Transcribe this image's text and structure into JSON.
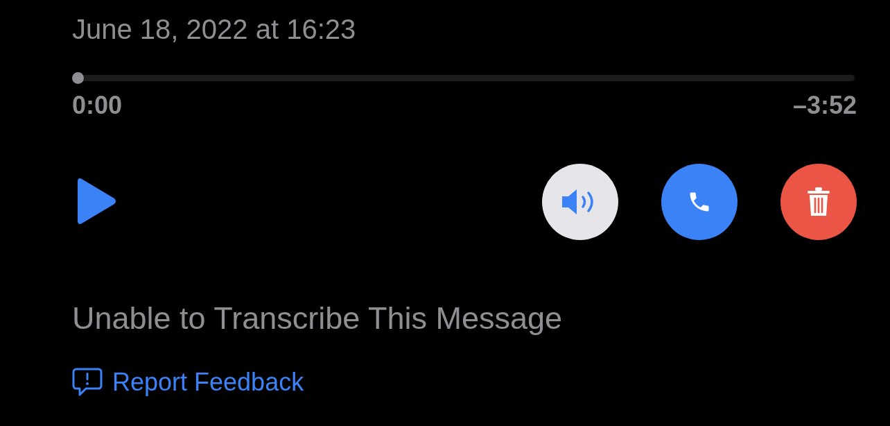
{
  "message": {
    "date": "June 18, 2022 at 16:23"
  },
  "playback": {
    "level": 0,
    "elapsed": "0:00",
    "remaining": "–3:52"
  },
  "actions": [
    {
      "kind": "speaker"
    },
    {
      "kind": "call"
    },
    {
      "kind": "delete"
    }
  ],
  "transcription": {
    "status": "Unable to Transcribe This Message"
  },
  "feedback": {
    "label": "Report Feedback"
  }
}
